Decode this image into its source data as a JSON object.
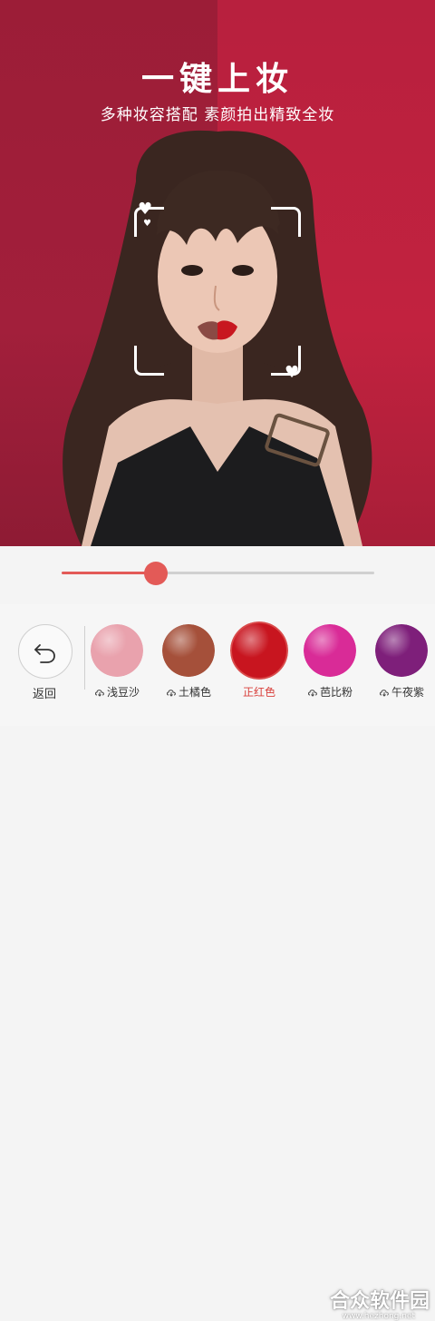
{
  "hero": {
    "title": "一键上妆",
    "subtitle": "多种妆容搭配 素颜拍出精致全妆"
  },
  "slider": {
    "value": 0.3
  },
  "toolbar": {
    "back_label": "返回",
    "swatches": [
      {
        "label": "浅豆沙",
        "color": "#e9a2ad",
        "selected": false,
        "download_icon": "cloud-download-icon"
      },
      {
        "label": "土橘色",
        "color": "#a5503a",
        "selected": false,
        "download_icon": "cloud-download-icon"
      },
      {
        "label": "正红色",
        "color": "#c8151f",
        "selected": true
      },
      {
        "label": "芭比粉",
        "color": "#d92b97",
        "selected": false,
        "download_icon": "cloud-download-icon"
      },
      {
        "label": "午夜紫",
        "color": "#7e1f7a",
        "selected": false,
        "download_icon": "cloud-download-icon"
      }
    ]
  },
  "colors": {
    "accent": "#e35a57",
    "hero_left": "#9c1d37",
    "hero_right": "#c2223f"
  },
  "watermark": {
    "text": "合众软件园",
    "url": "www.hezhong.net"
  }
}
